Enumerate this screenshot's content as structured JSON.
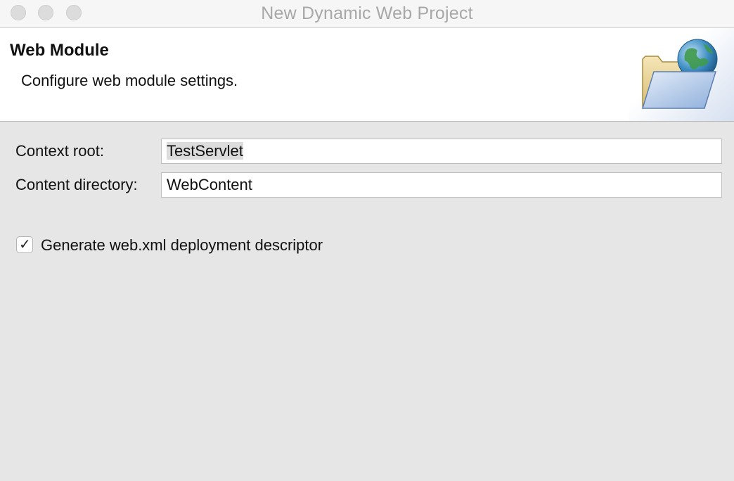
{
  "window": {
    "title": "New Dynamic Web Project"
  },
  "banner": {
    "title": "Web Module",
    "description": "Configure web module settings.",
    "icon": "folder-globe-icon"
  },
  "form": {
    "context_root": {
      "label": "Context root:",
      "value": "TestServlet"
    },
    "content_directory": {
      "label": "Content directory:",
      "value": "WebContent"
    },
    "generate_descriptor": {
      "label": "Generate web.xml deployment descriptor",
      "checked": true
    }
  }
}
